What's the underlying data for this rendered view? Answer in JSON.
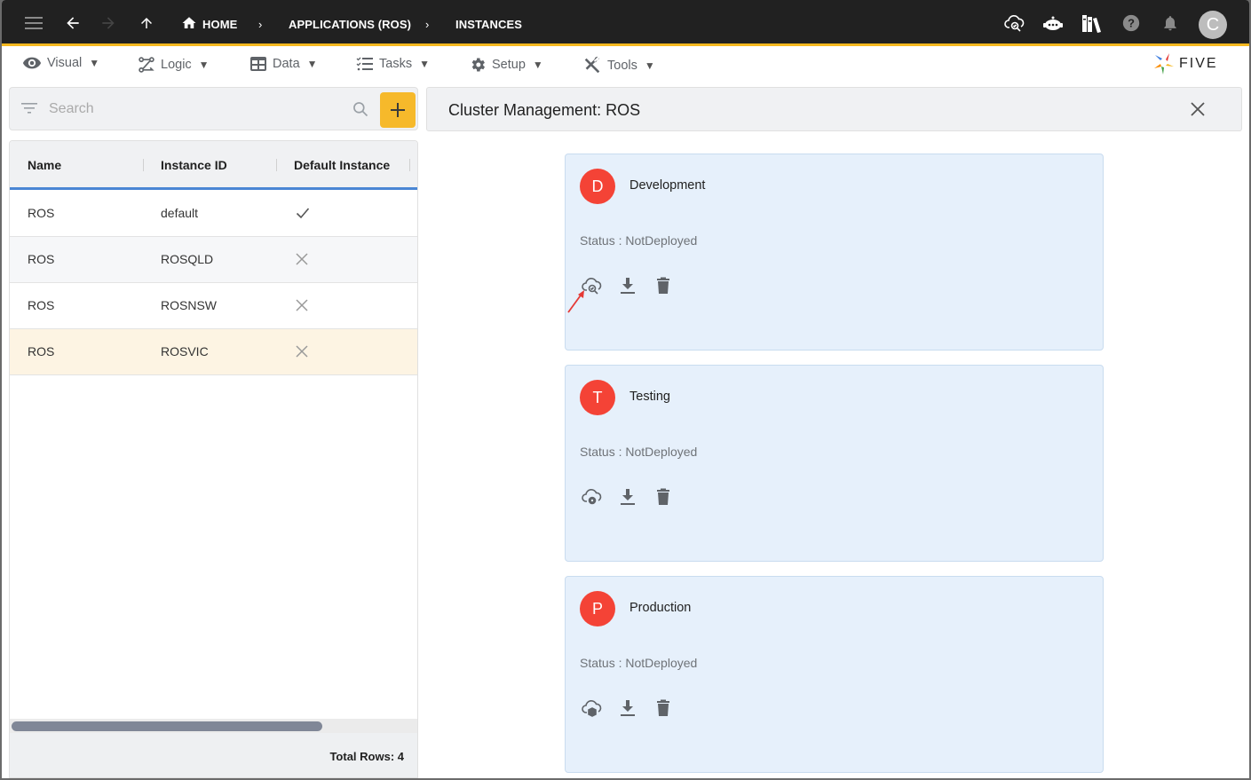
{
  "topbar": {
    "menu_icon": "hamburger-icon",
    "back_icon": "arrow-left-icon",
    "forward_icon": "arrow-right-icon",
    "up_icon": "arrow-up-icon",
    "breadcrumbs": [
      {
        "label": "HOME",
        "icon": "home-icon"
      },
      {
        "label": "APPLICATIONS (ROS)"
      },
      {
        "label": "INSTANCES"
      }
    ],
    "right_icons": [
      "cloud-search-icon",
      "chatbot-icon",
      "library-books-icon",
      "help-icon",
      "bell-icon"
    ],
    "avatar_letter": "C"
  },
  "menubar": {
    "items": [
      {
        "label": "Visual",
        "icon": "eye-icon"
      },
      {
        "label": "Logic",
        "icon": "logic-flow-icon"
      },
      {
        "label": "Data",
        "icon": "table-icon"
      },
      {
        "label": "Tasks",
        "icon": "checklist-icon"
      },
      {
        "label": "Setup",
        "icon": "gear-icon"
      },
      {
        "label": "Tools",
        "icon": "tools-icon"
      }
    ],
    "caret": "▼",
    "logo_text": "FIVE"
  },
  "search": {
    "placeholder": "Search",
    "value": ""
  },
  "grid": {
    "columns": [
      "Name",
      "Instance ID",
      "Default Instance"
    ],
    "rows": [
      {
        "name": "ROS",
        "instance_id": "default",
        "default": true
      },
      {
        "name": "ROS",
        "instance_id": "ROSQLD",
        "default": false
      },
      {
        "name": "ROS",
        "instance_id": "ROSNSW",
        "default": false
      },
      {
        "name": "ROS",
        "instance_id": "ROSVIC",
        "default": false,
        "selected": true
      }
    ],
    "total_rows_label": "Total Rows: 4"
  },
  "panel": {
    "title": "Cluster Management: ROS",
    "environments": [
      {
        "letter": "D",
        "name": "Development",
        "status": "Status : NotDeployed",
        "action_icon": "cloud-search-icon"
      },
      {
        "letter": "T",
        "name": "Testing",
        "status": "Status : NotDeployed",
        "action_icon": "cloud-settings-icon"
      },
      {
        "letter": "P",
        "name": "Production",
        "status": "Status : NotDeployed",
        "action_icon": "cloud-package-icon"
      }
    ]
  },
  "colors": {
    "topbar_bg": "#212121",
    "accent_yellow": "#f6b81f",
    "grid_header_underline": "#4a86d4",
    "selected_row": "#fdf4e3",
    "card_bg": "#e6f0fb",
    "avatar_red": "#f44336"
  }
}
